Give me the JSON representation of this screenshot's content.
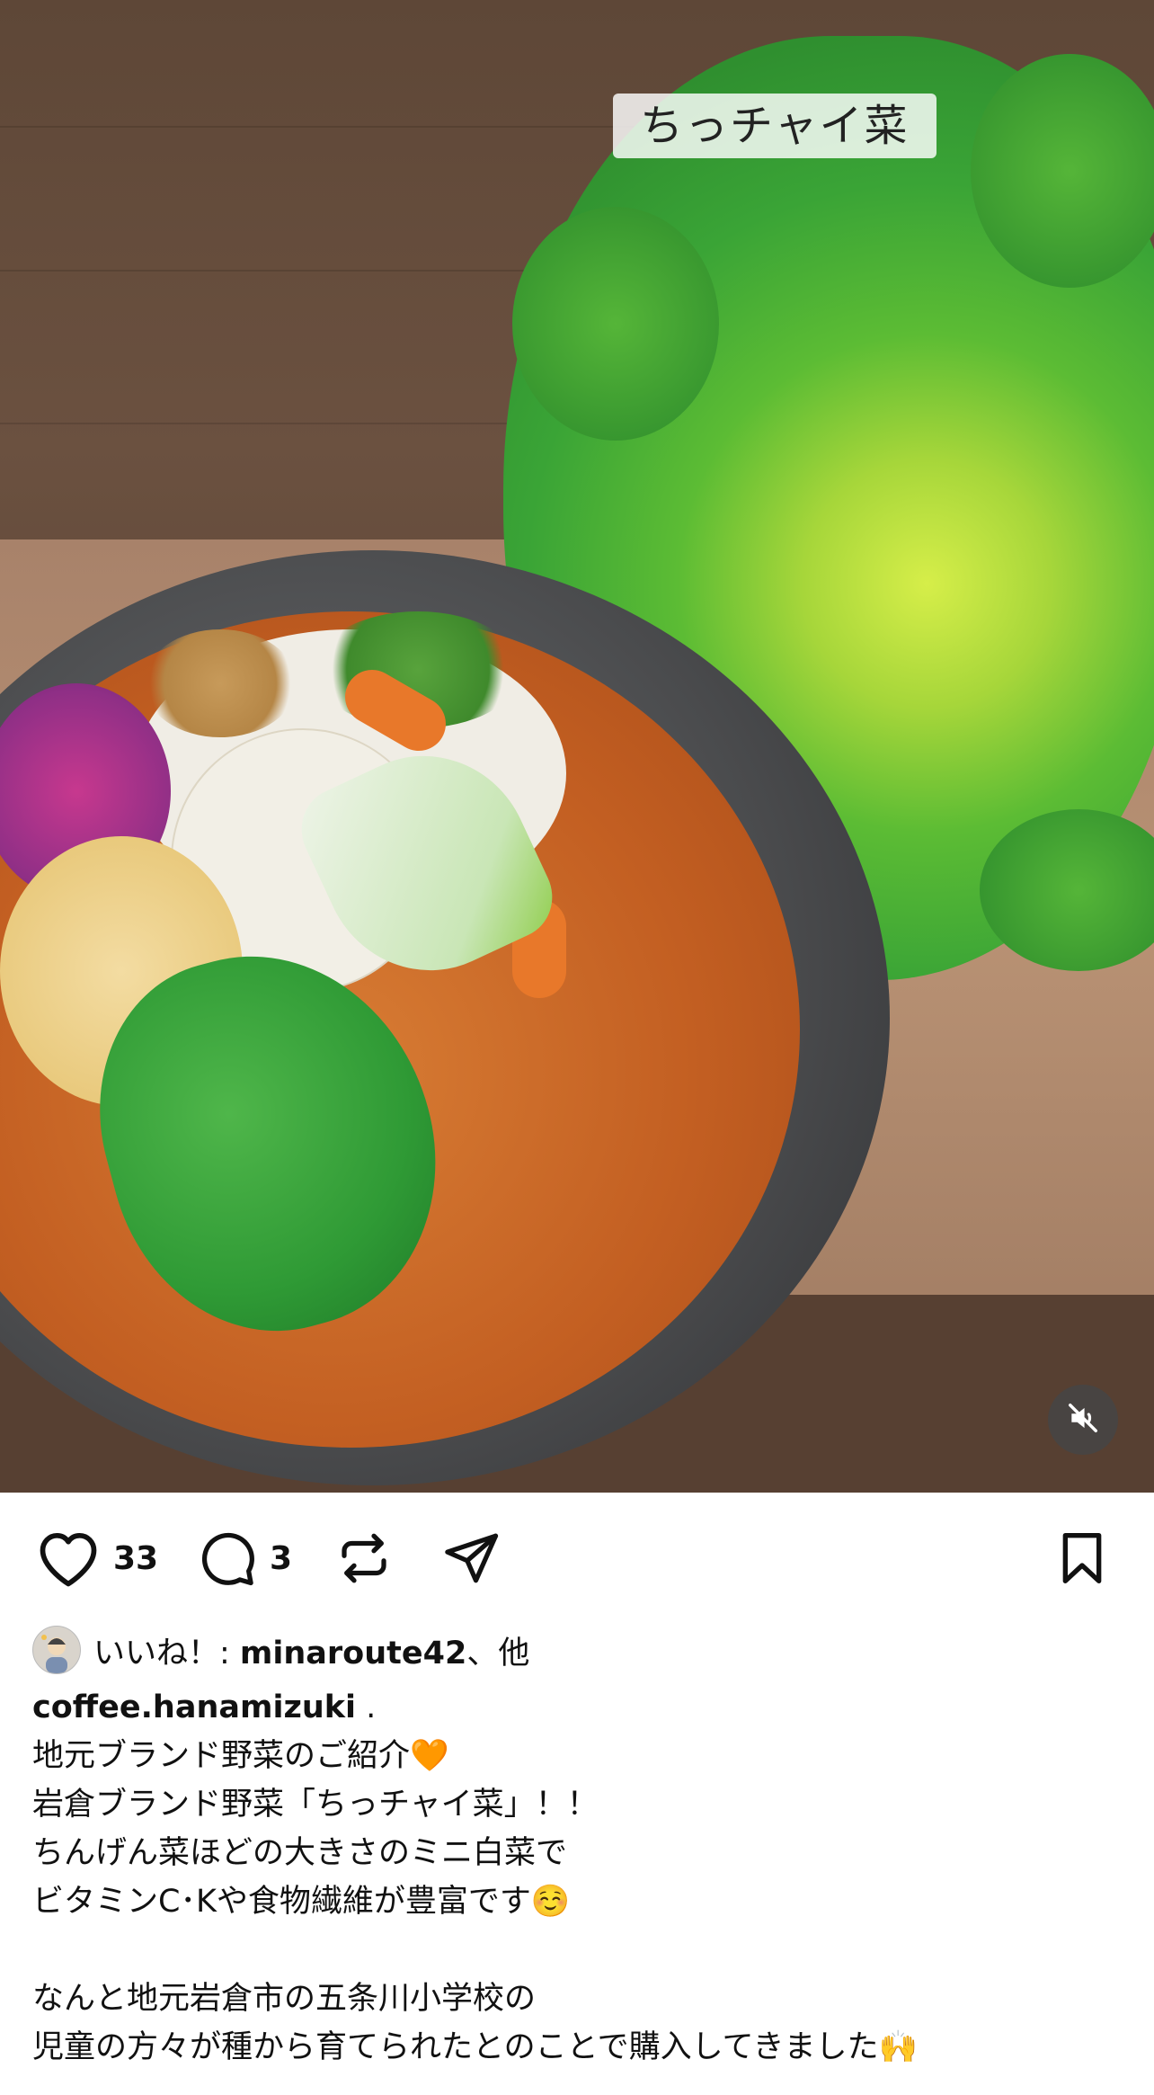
{
  "photo": {
    "overlay_label": "ちっチャイ菜",
    "mute_icon": "speaker-muted-icon"
  },
  "actions": {
    "like_icon": "heart-icon",
    "like_count": "33",
    "comment_icon": "comment-bubble-icon",
    "comment_count": "3",
    "repost_icon": "repost-icon",
    "share_icon": "send-paper-plane-icon",
    "save_icon": "bookmark-icon"
  },
  "likes": {
    "prefix": "いいね！: ",
    "user": "minaroute42",
    "suffix": "、他"
  },
  "caption": {
    "username": "coffee.hanamizuki",
    "username_suffix": " .",
    "lines": [
      "地元ブランド野菜のご紹介🧡",
      "岩倉ブランド野菜「ちっチャイ菜」！！",
      "ちんげん菜ほどの大きさのミニ白菜で",
      "ビタミンC･Kや食物繊維が豊富です☺️",
      "",
      "なんと地元岩倉市の五条川小学校の",
      "児童の方々が種から育てられたとのことで購入してきました🙌"
    ]
  },
  "colors": {
    "text": "#111111",
    "background": "#ffffff"
  }
}
